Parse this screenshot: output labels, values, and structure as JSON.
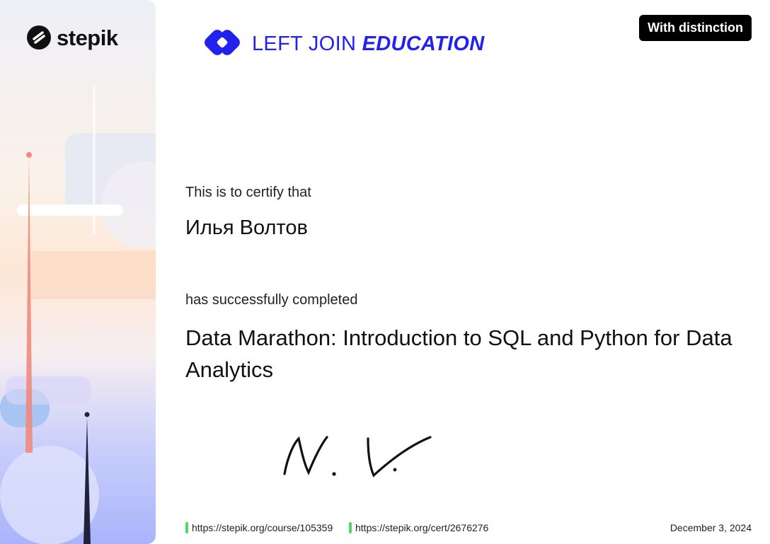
{
  "brand": {
    "name": "stepik"
  },
  "partner": {
    "part1": "LEFT JOIN ",
    "part2": "EDUCATION"
  },
  "badge": {
    "label": "With distinction"
  },
  "certificate": {
    "intro": "This is to certify that",
    "recipient": "Илья Волтов",
    "completed_text": "has successfully completed",
    "course_title": "Data Marathon: Introduction to SQL and Python for Data Analytics",
    "date": "December 3, 2024"
  },
  "links": {
    "course_url": "https://stepik.org/course/105359",
    "cert_url": "https://stepik.org/cert/2676276"
  },
  "colors": {
    "accent_link_bar": "#4cd964",
    "partner_blue": "#2222ee",
    "badge_bg": "#000000"
  },
  "icons": [
    "stepik-logo-icon",
    "left-join-logo-icon",
    "signature-drawing"
  ]
}
